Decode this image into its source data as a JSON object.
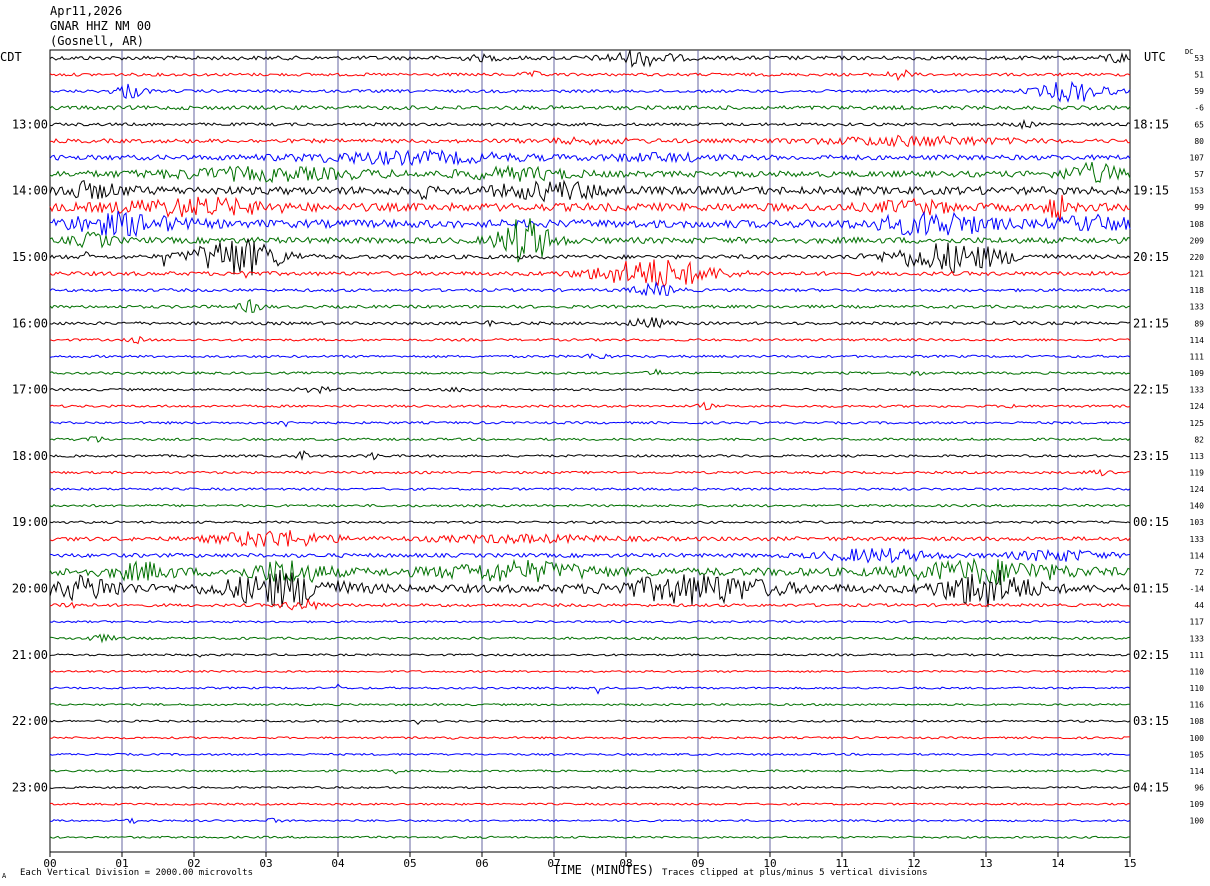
{
  "header": {
    "date": "Apr11,2026",
    "station": "GNAR HHZ NM 00",
    "location": "(Gosnell, AR)"
  },
  "left_label": "CDT",
  "right_label": "UTC",
  "dc_label": "DC",
  "footer": {
    "scale_note": "Each Vertical Division = 2000.00 microvolts",
    "clip_note": "Traces clipped at plus/minus 5 vertical divisions",
    "corner_mark": "A"
  },
  "colors": {
    "trace_cycle": [
      "#000000",
      "#ff0000",
      "#0000ff",
      "#007000"
    ],
    "grid": "#6464a0",
    "frame": "#000000"
  },
  "chart_data": {
    "type": "line",
    "title": "",
    "xlabel": "TIME (MINUTES)",
    "xlim": [
      0,
      15
    ],
    "x_ticks": [
      "00",
      "01",
      "02",
      "03",
      "04",
      "05",
      "06",
      "07",
      "08",
      "09",
      "10",
      "11",
      "12",
      "13",
      "14",
      "15"
    ],
    "trace_interval_minutes": 15,
    "left_time_labels": [
      {
        "row": 4,
        "label": "13:00"
      },
      {
        "row": 8,
        "label": "14:00"
      },
      {
        "row": 12,
        "label": "15:00"
      },
      {
        "row": 16,
        "label": "16:00"
      },
      {
        "row": 20,
        "label": "17:00"
      },
      {
        "row": 24,
        "label": "18:00"
      },
      {
        "row": 28,
        "label": "19:00"
      },
      {
        "row": 32,
        "label": "20:00"
      },
      {
        "row": 36,
        "label": "21:00"
      },
      {
        "row": 40,
        "label": "22:00"
      },
      {
        "row": 44,
        "label": "23:00"
      }
    ],
    "right_time_labels": [
      {
        "row": 4,
        "label": "18:15"
      },
      {
        "row": 8,
        "label": "19:15"
      },
      {
        "row": 12,
        "label": "20:15"
      },
      {
        "row": 16,
        "label": "21:15"
      },
      {
        "row": 20,
        "label": "22:15"
      },
      {
        "row": 24,
        "label": "23:15"
      },
      {
        "row": 28,
        "label": "00:15"
      },
      {
        "row": 32,
        "label": "01:15"
      },
      {
        "row": 36,
        "label": "02:15"
      },
      {
        "row": 40,
        "label": "03:15"
      },
      {
        "row": 44,
        "label": "04:15"
      }
    ],
    "dc_offsets": [
      "53",
      "51",
      "59",
      "-6",
      "65",
      "80",
      "107",
      "57",
      "153",
      "99",
      "108",
      "209",
      "220",
      "121",
      "118",
      "133",
      "89",
      "114",
      "111",
      "109",
      "133",
      "124",
      "125",
      "82",
      "113",
      "119",
      "124",
      "140",
      "103",
      "133",
      "114",
      "72",
      "-14",
      "44",
      "117",
      "133",
      "111",
      "110",
      "110",
      "116",
      "108",
      "100",
      "105",
      "114",
      "96",
      "109",
      "100"
    ],
    "traces": [
      {
        "row": 0,
        "noise": 2,
        "events": [
          {
            "t": 8.2,
            "w": 0.9,
            "a": 7
          },
          {
            "t": 14.8,
            "w": 0.3,
            "a": 5
          },
          {
            "t": 6,
            "w": 0.5,
            "a": 2
          }
        ]
      },
      {
        "row": 1,
        "noise": 1.5,
        "events": [
          {
            "t": 11.8,
            "w": 0.3,
            "a": 5
          },
          {
            "t": 6.7,
            "w": 0.3,
            "a": 2
          }
        ]
      },
      {
        "row": 2,
        "noise": 1.5,
        "events": [
          {
            "t": 1.1,
            "w": 0.4,
            "a": 7
          },
          {
            "t": 14.2,
            "w": 0.9,
            "a": 10
          }
        ]
      },
      {
        "row": 3,
        "noise": 2,
        "events": []
      },
      {
        "row": 4,
        "noise": 1.5,
        "events": [
          {
            "t": 13.5,
            "w": 0.3,
            "a": 3
          }
        ]
      },
      {
        "row": 5,
        "noise": 2,
        "events": [
          {
            "t": 12,
            "w": 2.5,
            "a": 4
          },
          {
            "t": 7.5,
            "w": 1.5,
            "a": 2
          }
        ]
      },
      {
        "row": 6,
        "noise": 2.5,
        "events": [
          {
            "t": 5,
            "w": 3,
            "a": 5
          },
          {
            "t": 8.5,
            "w": 1.5,
            "a": 3
          }
        ]
      },
      {
        "row": 7,
        "noise": 3,
        "events": [
          {
            "t": 14.5,
            "w": 0.8,
            "a": 9
          },
          {
            "t": 3,
            "w": 3,
            "a": 5
          },
          {
            "t": 6.5,
            "w": 1.5,
            "a": 5
          }
        ]
      },
      {
        "row": 8,
        "noise": 4,
        "events": [
          {
            "t": 0.5,
            "w": 1,
            "a": 6
          },
          {
            "t": 7,
            "w": 1.5,
            "a": 7
          },
          {
            "t": 5.2,
            "w": 0.1,
            "a": 8
          }
        ]
      },
      {
        "row": 9,
        "noise": 4,
        "events": [
          {
            "t": 2,
            "w": 2,
            "a": 7
          },
          {
            "t": 14,
            "w": 0.3,
            "a": 11
          },
          {
            "t": 12,
            "w": 1,
            "a": 5
          }
        ]
      },
      {
        "row": 10,
        "noise": 4,
        "events": [
          {
            "t": 1,
            "w": 1.5,
            "a": 9
          },
          {
            "t": 12.3,
            "w": 1.5,
            "a": 10
          },
          {
            "t": 14.5,
            "w": 1,
            "a": 6
          }
        ]
      },
      {
        "row": 11,
        "noise": 3,
        "events": [
          {
            "t": 6.6,
            "w": 0.7,
            "a": 22
          },
          {
            "t": 0.6,
            "w": 0.5,
            "a": 6
          }
        ]
      },
      {
        "row": 12,
        "noise": 2,
        "events": [
          {
            "t": 2.6,
            "w": 1.2,
            "a": 19
          },
          {
            "t": 12.5,
            "w": 1.6,
            "a": 14
          },
          {
            "t": 0.5,
            "w": 0.05,
            "a": 9
          },
          {
            "t": 1.6,
            "w": 0.05,
            "a": 12
          }
        ]
      },
      {
        "row": 13,
        "noise": 2,
        "events": [
          {
            "t": 8.4,
            "w": 1.6,
            "a": 14
          },
          {
            "t": 2.7,
            "w": 0.1,
            "a": 7
          }
        ]
      },
      {
        "row": 14,
        "noise": 1.5,
        "events": [
          {
            "t": 8.4,
            "w": 0.6,
            "a": 6
          }
        ]
      },
      {
        "row": 15,
        "noise": 1.5,
        "events": [
          {
            "t": 2.8,
            "w": 0.3,
            "a": 6
          }
        ]
      },
      {
        "row": 16,
        "noise": 1.5,
        "events": [
          {
            "t": 8.3,
            "w": 0.5,
            "a": 5
          },
          {
            "t": 6.1,
            "w": 0.1,
            "a": 3
          },
          {
            "t": 13.4,
            "w": 0.1,
            "a": 3
          }
        ]
      },
      {
        "row": 17,
        "noise": 1.2,
        "events": [
          {
            "t": 1.2,
            "w": 0.2,
            "a": 3
          }
        ]
      },
      {
        "row": 18,
        "noise": 1.2,
        "events": [
          {
            "t": 7.6,
            "w": 0.3,
            "a": 3
          }
        ]
      },
      {
        "row": 19,
        "noise": 1.2,
        "events": [
          {
            "t": 8.4,
            "w": 0.2,
            "a": 3
          },
          {
            "t": 12,
            "w": 0.2,
            "a": 3
          }
        ]
      },
      {
        "row": 20,
        "noise": 1.2,
        "events": [
          {
            "t": 3.7,
            "w": 0.4,
            "a": 3
          },
          {
            "t": 5.7,
            "w": 0.3,
            "a": 2
          }
        ]
      },
      {
        "row": 21,
        "noise": 1.2,
        "events": [
          {
            "t": 9.1,
            "w": 0.2,
            "a": 3
          },
          {
            "t": 13.4,
            "w": 0.2,
            "a": 2
          }
        ]
      },
      {
        "row": 22,
        "noise": 1.2,
        "events": [
          {
            "t": 3.3,
            "w": 0.3,
            "a": 3
          }
        ]
      },
      {
        "row": 23,
        "noise": 1.2,
        "events": [
          {
            "t": 0.6,
            "w": 0.3,
            "a": 3
          }
        ]
      },
      {
        "row": 24,
        "noise": 1.2,
        "events": [
          {
            "t": 3.5,
            "w": 0.2,
            "a": 4
          },
          {
            "t": 4.5,
            "w": 0.2,
            "a": 3
          }
        ]
      },
      {
        "row": 25,
        "noise": 1.2,
        "events": [
          {
            "t": 14.6,
            "w": 0.3,
            "a": 3
          }
        ]
      },
      {
        "row": 26,
        "noise": 1.2,
        "events": []
      },
      {
        "row": 27,
        "noise": 1.2,
        "events": []
      },
      {
        "row": 28,
        "noise": 1.2,
        "events": []
      },
      {
        "row": 29,
        "noise": 2,
        "events": [
          {
            "t": 3.1,
            "w": 1.5,
            "a": 8
          },
          {
            "t": 6.5,
            "w": 2.5,
            "a": 3
          }
        ]
      },
      {
        "row": 30,
        "noise": 2,
        "events": [
          {
            "t": 11.5,
            "w": 1.5,
            "a": 6
          },
          {
            "t": 14,
            "w": 1.2,
            "a": 5
          }
        ]
      },
      {
        "row": 31,
        "noise": 4,
        "events": [
          {
            "t": 1.3,
            "w": 0.8,
            "a": 7
          },
          {
            "t": 3.3,
            "w": 1,
            "a": 10
          },
          {
            "t": 6.5,
            "w": 2,
            "a": 8
          },
          {
            "t": 13,
            "w": 2,
            "a": 10
          }
        ]
      },
      {
        "row": 32,
        "noise": 4,
        "events": [
          {
            "t": 3.2,
            "w": 1.5,
            "a": 16
          },
          {
            "t": 9,
            "w": 2,
            "a": 13
          },
          {
            "t": 13,
            "w": 1.2,
            "a": 17
          },
          {
            "t": 0.5,
            "w": 1,
            "a": 10
          }
        ]
      },
      {
        "row": 33,
        "noise": 1.5,
        "events": [
          {
            "t": 3.5,
            "w": 0.5,
            "a": 5
          },
          {
            "t": 0.3,
            "w": 0.3,
            "a": 3
          }
        ]
      },
      {
        "row": 34,
        "noise": 1,
        "events": []
      },
      {
        "row": 35,
        "noise": 1.2,
        "events": [
          {
            "t": 0.7,
            "w": 0.4,
            "a": 3
          }
        ]
      },
      {
        "row": 36,
        "noise": 1,
        "events": [
          {
            "t": 2.1,
            "w": 0.05,
            "a": 4
          }
        ]
      },
      {
        "row": 37,
        "noise": 1,
        "events": []
      },
      {
        "row": 38,
        "noise": 1,
        "events": [
          {
            "t": 7.6,
            "w": 0.05,
            "a": 6
          },
          {
            "t": 4,
            "w": 0.05,
            "a": 4
          }
        ]
      },
      {
        "row": 39,
        "noise": 1,
        "events": []
      },
      {
        "row": 40,
        "noise": 1,
        "events": [
          {
            "t": 5.1,
            "w": 0.05,
            "a": 4
          }
        ]
      },
      {
        "row": 41,
        "noise": 1,
        "events": [
          {
            "t": 5.6,
            "w": 0.05,
            "a": 4
          }
        ]
      },
      {
        "row": 42,
        "noise": 1,
        "events": []
      },
      {
        "row": 43,
        "noise": 1,
        "events": [
          {
            "t": 4.8,
            "w": 0.05,
            "a": 3
          }
        ]
      },
      {
        "row": 44,
        "noise": 1,
        "events": []
      },
      {
        "row": 45,
        "noise": 1,
        "events": [
          {
            "t": 8.3,
            "w": 0.1,
            "a": 4
          }
        ]
      },
      {
        "row": 46,
        "noise": 1,
        "events": [
          {
            "t": 1.1,
            "w": 0.2,
            "a": 3
          },
          {
            "t": 3.1,
            "w": 0.2,
            "a": 2
          }
        ]
      },
      {
        "row": 47,
        "noise": 1,
        "events": []
      }
    ]
  }
}
